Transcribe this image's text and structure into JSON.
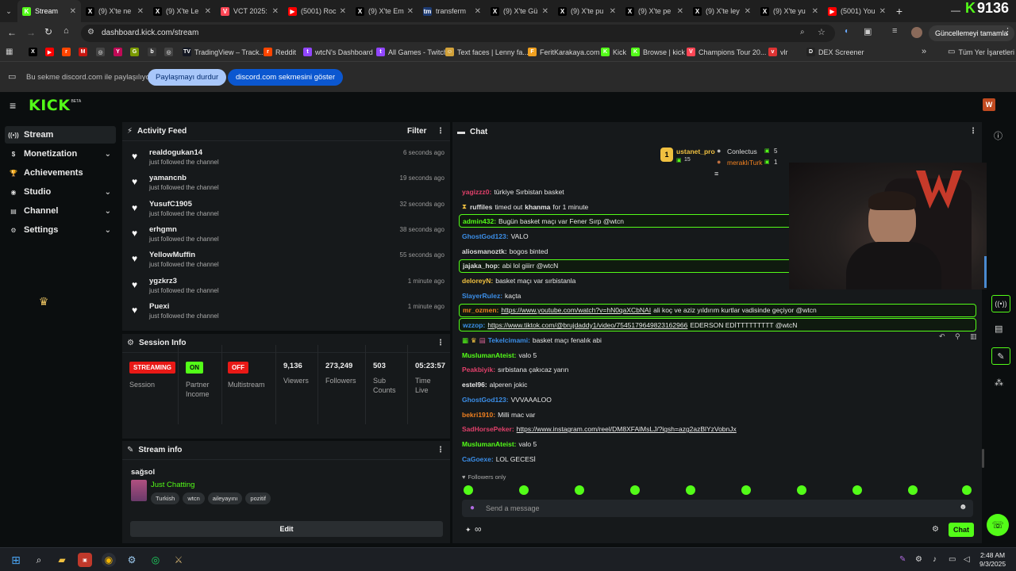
{
  "browser": {
    "tabs": [
      {
        "label": "Stream",
        "fav": "K",
        "color": "#53fc18",
        "active": true
      },
      {
        "label": "(9) X'te ne",
        "fav": "X",
        "color": "#000000"
      },
      {
        "label": "(9) X'te Le",
        "fav": "X",
        "color": "#000000"
      },
      {
        "label": "VCT 2025:",
        "fav": "V",
        "color": "#ff4655"
      },
      {
        "label": "(5001) Roc",
        "fav": "▶",
        "color": "#ff0000"
      },
      {
        "label": "(9) X'te Em",
        "fav": "X",
        "color": "#000000"
      },
      {
        "label": "transferm",
        "fav": "tm",
        "color": "#1d3b73"
      },
      {
        "label": "(9) X'te Gü",
        "fav": "X",
        "color": "#000000"
      },
      {
        "label": "(9) X'te pu",
        "fav": "X",
        "color": "#000000"
      },
      {
        "label": "(9) X'te pe",
        "fav": "X",
        "color": "#000000"
      },
      {
        "label": "(9) X'te ley",
        "fav": "X",
        "color": "#000000"
      },
      {
        "label": "(9) X'te yu",
        "fav": "X",
        "color": "#000000"
      },
      {
        "label": "(5001) You",
        "fav": "▶",
        "color": "#ff0000"
      }
    ],
    "new_tab": "+",
    "url": "dashboard.kick.com/stream",
    "update_label": "Güncellemeyi tamamla",
    "bookmarks": [
      {
        "label": "",
        "ic": "X",
        "color": "#000000"
      },
      {
        "label": "",
        "ic": "▶",
        "color": "#ff0000"
      },
      {
        "label": "",
        "ic": "r",
        "color": "#ff4500"
      },
      {
        "label": "",
        "ic": "M",
        "color": "#c71610"
      },
      {
        "label": "",
        "ic": "◎",
        "color": "#444444"
      },
      {
        "label": "",
        "ic": "Y",
        "color": "#c00a56"
      },
      {
        "label": "",
        "ic": "G",
        "color": "#7a9a01"
      },
      {
        "label": "",
        "ic": "b",
        "color": "#3a3a3a"
      },
      {
        "label": "",
        "ic": "◎",
        "color": "#444444"
      },
      {
        "label": "TradingView – Track...",
        "ic": "TV",
        "color": "#131722"
      },
      {
        "label": "Reddit",
        "ic": "r",
        "color": "#ff4500"
      },
      {
        "label": "wtcN's Dashboard",
        "ic": "t",
        "color": "#9146ff"
      },
      {
        "label": "All Games - Twitch",
        "ic": "t",
        "color": "#9146ff"
      },
      {
        "label": "Text faces | Lenny fa...",
        "ic": "☺",
        "color": "#d2a23a"
      },
      {
        "label": "FeritKarakaya.com",
        "ic": "F",
        "color": "#f0a020"
      },
      {
        "label": "Kick",
        "ic": "K",
        "color": "#53fc18"
      },
      {
        "label": "Browse | kick",
        "ic": "K",
        "color": "#53fc18"
      },
      {
        "label": "Champions Tour 20...",
        "ic": "V",
        "color": "#ff4655"
      },
      {
        "label": "vlr",
        "ic": "v",
        "color": "#d33"
      },
      {
        "label": "DEX Screener",
        "ic": "D",
        "color": "#222222"
      }
    ],
    "bookmarks_more": "»",
    "all_bookmarks": "Tüm Yer İşaretleri",
    "share_text": "Bu sekme discord.com ile paylaşılıyor",
    "stop_sharing": "Paylaşmayı durdur",
    "show_tab": "discord.com sekmesini göster",
    "overlay_count": "9136"
  },
  "kick": {
    "logo": "KICK",
    "logo_badge": "BETA"
  },
  "nav": {
    "items": [
      {
        "label": "Stream",
        "icon": "((•))",
        "chev": false,
        "active": true
      },
      {
        "label": "Monetization",
        "icon": "$",
        "chev": true
      },
      {
        "label": "Achievements",
        "icon": "🏆",
        "chev": false
      },
      {
        "label": "Studio",
        "icon": "◉",
        "chev": true
      },
      {
        "label": "Channel",
        "icon": "▤",
        "chev": true
      },
      {
        "label": "Settings",
        "icon": "⚙",
        "chev": true
      }
    ]
  },
  "activity": {
    "title": "Activity Feed",
    "filter": "Filter",
    "items": [
      {
        "name": "realdogukan14",
        "sub": "just followed the channel",
        "time": "6 seconds ago"
      },
      {
        "name": "yamancnb",
        "sub": "just followed the channel",
        "time": "19 seconds ago"
      },
      {
        "name": "YusufC1905",
        "sub": "just followed the channel",
        "time": "32 seconds ago"
      },
      {
        "name": "erhgmn",
        "sub": "just followed the channel",
        "time": "38 seconds ago"
      },
      {
        "name": "YellowMuffin",
        "sub": "just followed the channel",
        "time": "55 seconds ago"
      },
      {
        "name": "ygzkrz3",
        "sub": "just followed the channel",
        "time": "1 minute ago"
      },
      {
        "name": "Puexi",
        "sub": "just followed the channel",
        "time": "1 minute ago"
      }
    ]
  },
  "session": {
    "title": "Session Info",
    "streaming_badge": "STREAMING",
    "streaming_label": "Session",
    "partner_badge": "ON",
    "partner_label_1": "Partner",
    "partner_label_2": "Income",
    "multi_badge": "OFF",
    "multi_label": "Multistream",
    "viewers": "9,136",
    "viewers_label": "Viewers",
    "followers": "273,249",
    "followers_label": "Followers",
    "subs": "503",
    "subs_label_1": "Sub",
    "subs_label_2": "Counts",
    "time": "05:23:57",
    "time_label_1": "Time",
    "time_label_2": "Live"
  },
  "stream_info": {
    "title": "Stream info",
    "stream_title": "sağsol",
    "category": "Just Chatting",
    "tags": [
      "Turkish",
      "wtcn",
      "aileyayını",
      "pozitif"
    ],
    "edit": "Edit"
  },
  "chat": {
    "title": "Chat",
    "top1_name": "ustanet_pro",
    "top1_count": "15",
    "top2_name": "Conlectus",
    "top2_count": "5",
    "top3_name": "meraklıTurk",
    "top3_count": "1",
    "lines": [
      {
        "user": "yagizzz0:",
        "ucolor": "#e0406a",
        "msg": "türkiye Sırbistan basket",
        "hl": false
      },
      {
        "user": "ruffiles",
        "ucolor": "#dddddd",
        "msg": "timed out",
        "msg2": "khanma",
        "msg3": "for 1 minute",
        "hl": false,
        "system": true
      },
      {
        "user": "admin432:",
        "ucolor": "#53fc18",
        "msg": "Bugün basket maçı var Fener Sırp @wtcn",
        "hl": true
      },
      {
        "user": "GhostGod123:",
        "ucolor": "#3b8ee8",
        "msg": "VALO",
        "hl": false
      },
      {
        "user": "aliosmanoztk:",
        "ucolor": "#dddddd",
        "msg": "bogos binted",
        "hl": false
      },
      {
        "user": "jajaka_hop:",
        "ucolor": "#dddddd",
        "msg": "abi lol giiirr @wtcN",
        "hl": true
      },
      {
        "user": "deloreyN:",
        "ucolor": "#f0c040",
        "msg": "basket maçı var sırbistanla",
        "hl": false
      },
      {
        "user": "SlayerRulez:",
        "ucolor": "#3b8ee8",
        "msg": "kaçta",
        "hl": false
      },
      {
        "user": "mr_ozmen:",
        "ucolor": "#f08020",
        "link": "https://www.youtube.com/watch?v=hN0qaXCbNAI",
        "msg": "ali koç ve aziz yıldırım kurtlar vadisinde geçiyor @wtcn",
        "hl": true
      },
      {
        "user": "wzzop:",
        "ucolor": "#3b8ee8",
        "link": "https://www.tiktok.com/@brujdaddy1/video/7545179649823162966",
        "msg": "EDERSON EDİTTTTTTTTT @wtcN",
        "hl": true
      },
      {
        "user": "Tekelcimami:",
        "ucolor": "#3b8ee8",
        "msg": "basket maçı fenalık abi",
        "hl": false,
        "badges": true
      },
      {
        "user": "MuslumanAteist:",
        "ucolor": "#53fc18",
        "msg": "valo 5",
        "hl": false
      },
      {
        "user": "Peakbiyik:",
        "ucolor": "#e0406a",
        "msg": "sırbistana çakıcaz yarın",
        "hl": false
      },
      {
        "user": "estel96:",
        "ucolor": "#e8e8e8",
        "msg": "alperen jokic",
        "hl": false
      },
      {
        "user": "GhostGod123:",
        "ucolor": "#3b8ee8",
        "msg": "VVVAAALOO",
        "hl": false
      },
      {
        "user": "bekri1910:",
        "ucolor": "#f08020",
        "msg": "Milli mac var",
        "hl": false
      },
      {
        "user": "SadHorsePeker:",
        "ucolor": "#e0406a",
        "link": "https://www.instagram.com/reel/DM8XFAlMsLJ/?igsh=azg2azBlYzVobnJx",
        "msg": "",
        "hl": false
      },
      {
        "user": "MuslumanAteist:",
        "ucolor": "#53fc18",
        "msg": "valo 5",
        "hl": false
      },
      {
        "user": "CaGoexe:",
        "ucolor": "#3b8ee8",
        "msg": "LOL GECESİ",
        "hl": false
      }
    ],
    "followers_only": "Followers only",
    "placeholder": "Send a message",
    "send": "Chat",
    "infinity": "∞"
  },
  "taskbar": {
    "time": "2:48 AM",
    "date": "9/3/2025"
  }
}
